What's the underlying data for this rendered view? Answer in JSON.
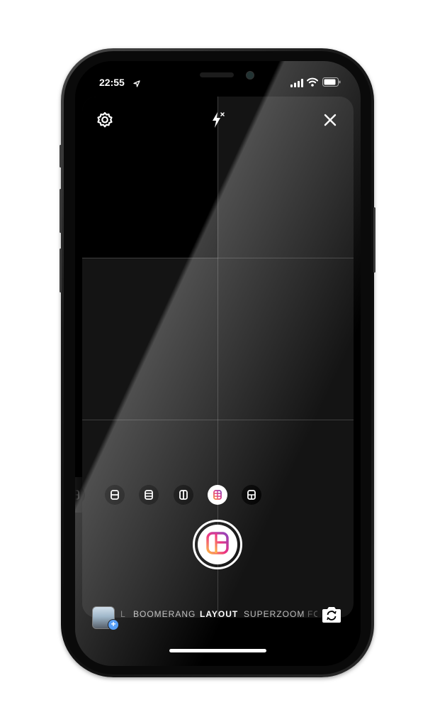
{
  "status_bar": {
    "time": "22:55",
    "location_icon": "location-arrow-icon",
    "signal_icon": "cellular-signal-icon",
    "wifi_icon": "wifi-icon",
    "battery_icon": "battery-icon"
  },
  "top_controls": {
    "settings_icon": "gear-icon",
    "flash_icon": "flash-off-icon",
    "close_icon": "close-icon"
  },
  "layout_picker": {
    "options": [
      "layout-2-stacked",
      "layout-2-stacked",
      "layout-3-stacked",
      "layout-2-side",
      "layout-6-grid",
      "layout-4-grid"
    ],
    "selected_index": 4
  },
  "shutter": {
    "icon": "layout-capture-icon"
  },
  "modes": {
    "left_partial": "L",
    "items": [
      "BOOMERANG",
      "LAYOUT",
      "SUPERZOOM"
    ],
    "right_partial": "FO",
    "active": "LAYOUT"
  },
  "bottom_controls": {
    "gallery_icon": "gallery-thumbnail",
    "gallery_add": "+",
    "flip_icon": "flip-camera-icon"
  },
  "colors": {
    "accent_gradient_start": "#f58529",
    "accent_gradient_mid": "#dd2a7b",
    "accent_gradient_end": "#8134af",
    "background": "#141414"
  }
}
